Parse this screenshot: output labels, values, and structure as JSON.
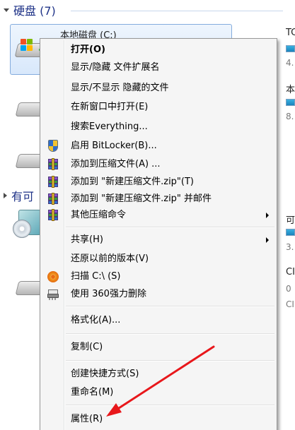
{
  "background": {
    "group_hdd": {
      "title": "硬盘 (7)"
    },
    "group_removable": {
      "title": "有可"
    },
    "selected_drive": {
      "label": "本地磁盘 (C:)"
    },
    "right_column": {
      "item1_title": "TC",
      "item1_size": "4.",
      "item2_title": "本",
      "item2_size": "8.",
      "item3_title": "可",
      "item3_size": "3.",
      "item4_title": "CI",
      "item4_line2": "0",
      "item4_line3": "CI"
    }
  },
  "context_menu": {
    "items": {
      "open": "打开(O)",
      "toggle_extensions": "显示/隐藏 文件扩展名",
      "toggle_hidden": "显示/不显示 隐藏的文件",
      "open_new_window": "在新窗口中打开(E)",
      "search_everything": "搜索Everything...",
      "bitlocker": "启用 BitLocker(B)...",
      "add_archive": "添加到压缩文件(A) ...",
      "add_zip": "添加到 \"新建压缩文件.zip\"(T)",
      "add_zip_email": "添加到 \"新建压缩文件.zip\" 并邮件",
      "more_compress": "其他压缩命令",
      "share": "共享(H)",
      "restore": "还原以前的版本(V)",
      "scan": "扫描 C:\\ (S)",
      "force_delete": "使用 360强力删除",
      "format": "格式化(A)...",
      "copy": "复制(C)",
      "create_shortcut": "创建快捷方式(S)",
      "rename": "重命名(M)",
      "properties": "属性(R)"
    }
  },
  "colors": {
    "menu_bg": "#f5f5f5",
    "selection_border": "#84acdd",
    "group_title": "#1e3287",
    "annotation_arrow": "#e8171b"
  }
}
